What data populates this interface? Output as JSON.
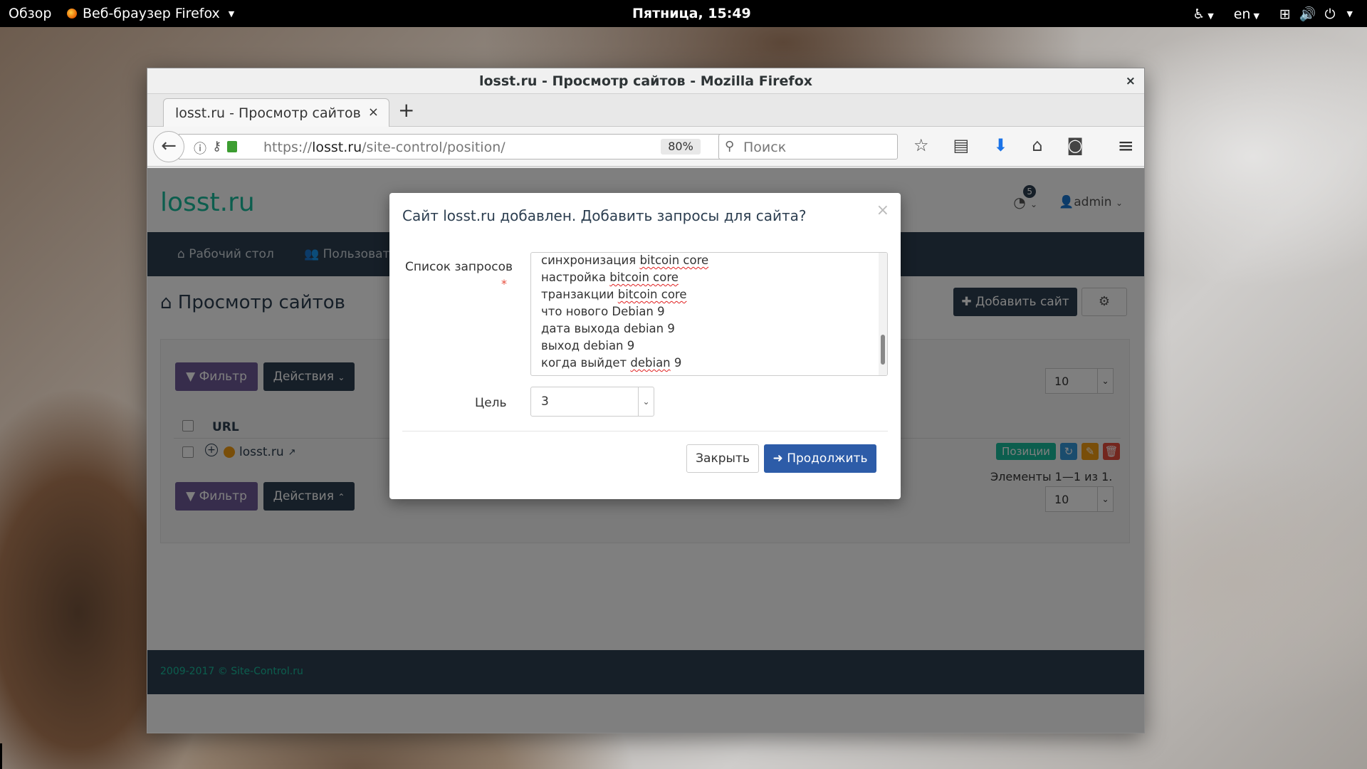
{
  "topbar": {
    "activities": "Обзор",
    "app_name": "Веб-браузер Firefox",
    "clock": "Пятница, 15:49",
    "lang": "en"
  },
  "window": {
    "title": "losst.ru - Просмотр сайтов - Mozilla Firefox",
    "close": "×"
  },
  "tab": {
    "label": "losst.ru - Просмотр сайтов",
    "close": "×",
    "new_tab": "+"
  },
  "navbar": {
    "url_prefix": "https://",
    "url_host": "losst.ru",
    "url_path": "/site-control/position/",
    "zoom": "80%",
    "search_placeholder": "Поиск"
  },
  "site": {
    "brand": "losst.ru",
    "notifications_count": "5",
    "user": "admin",
    "nav": {
      "dashboard": "Рабочий стол",
      "users": "Пользовате"
    },
    "page_title": "Просмотр сайтов",
    "add_site": "Добавить сайт",
    "filter": "Фильтр",
    "actions": "Действия",
    "page_size": "10",
    "col_url": "URL",
    "row": {
      "site": "losst.ru",
      "positions": "Позиции"
    },
    "summary": "Элементы 1—1 из 1.",
    "footer": "2009-2017 © Site-Control.ru"
  },
  "modal": {
    "title": "Сайт losst.ru добавлен. Добавить запросы для сайта?",
    "close_x": "×",
    "queries_label": "Список запросов",
    "required_mark": "*",
    "queries": [
      {
        "pre": "синхронизация ",
        "spell": "bitcoin core",
        "post": ""
      },
      {
        "pre": "настройка ",
        "spell": "bitcoin core",
        "post": ""
      },
      {
        "pre": "транзакции ",
        "spell": "bitcoin core",
        "post": ""
      },
      {
        "pre": "что нового Debian 9",
        "spell": "",
        "post": ""
      },
      {
        "pre": "дата выхода debian 9",
        "spell": "",
        "post": ""
      },
      {
        "pre": "выход debian 9",
        "spell": "",
        "post": ""
      },
      {
        "pre": "когда выйдет ",
        "spell": "debian",
        "post": " 9"
      }
    ],
    "goal_label": "Цель",
    "goal_value": "3",
    "close_button": "Закрыть",
    "continue_button": "Продолжить"
  },
  "colors": {
    "brand": "#18bc9c",
    "navbar": "#2c3e50",
    "primary_button": "#2d5ca8",
    "filter_button": "#6e5b98",
    "spell_underline": "#e02020"
  }
}
